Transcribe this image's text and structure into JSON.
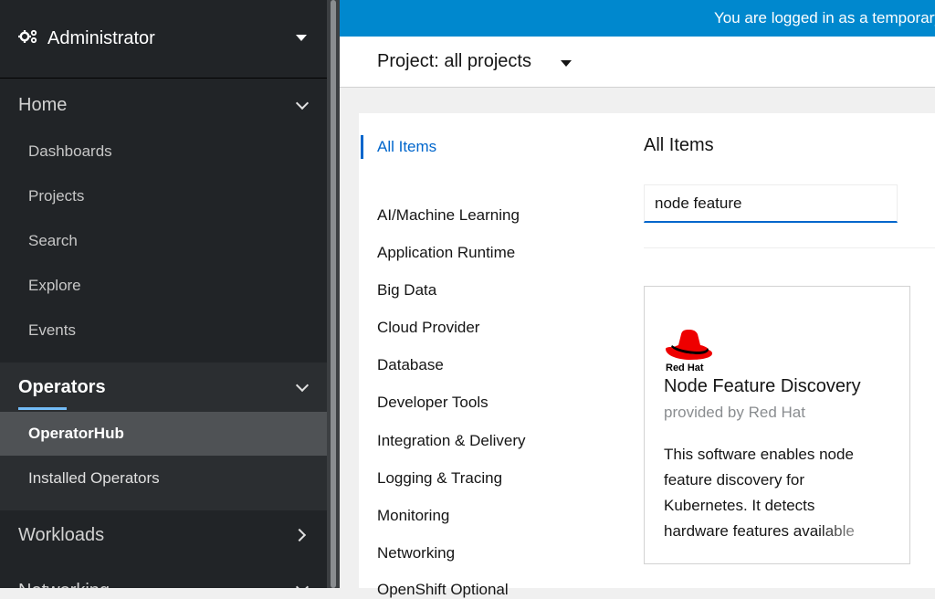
{
  "sidebar": {
    "perspective": "Administrator",
    "sections": {
      "home": "Home",
      "operators": "Operators",
      "workloads": "Workloads",
      "networking": "Networking"
    },
    "home_items": [
      "Dashboards",
      "Projects",
      "Search",
      "Explore",
      "Events"
    ],
    "operator_items": [
      "OperatorHub",
      "Installed Operators"
    ]
  },
  "banner": {
    "text": "You are logged in as a temporary administrative user."
  },
  "project": {
    "label": "Project: all projects"
  },
  "catalog": {
    "categories": [
      "All Items",
      "AI/Machine Learning",
      "Application Runtime",
      "Big Data",
      "Cloud Provider",
      "Database",
      "Developer Tools",
      "Integration & Delivery",
      "Logging & Tracing",
      "Monitoring",
      "Networking",
      "OpenShift Optional"
    ],
    "heading": "All Items",
    "filter_value": "node feature"
  },
  "tile": {
    "logo_text": "Red Hat",
    "title": "Node Feature Discovery",
    "provider": "provided by Red Hat",
    "description": "This software enables node feature discovery for Kubernetes. It detects hardware features available"
  },
  "colors": {
    "sidebar_bg": "#212427",
    "banner_bg": "#0088ce",
    "accent": "#0066cc",
    "redhat_red": "#ee0000"
  }
}
